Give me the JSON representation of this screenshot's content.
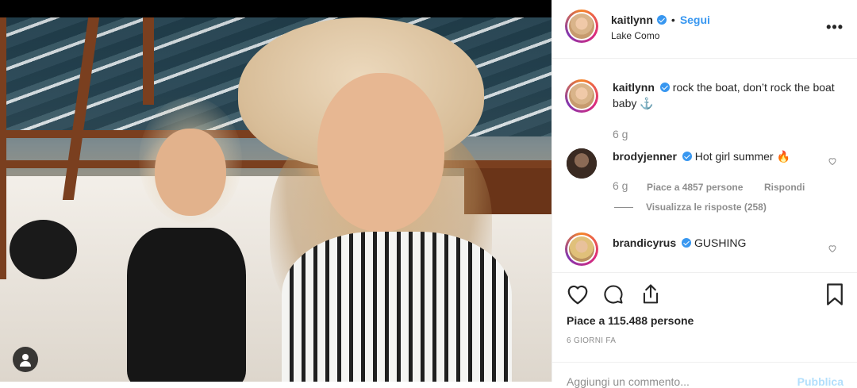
{
  "post": {
    "author": "kaitlynn",
    "follow_label": "Segui",
    "dot": "•",
    "location": "Lake Como",
    "more": "•••"
  },
  "caption": {
    "user": "kaitlynn",
    "text": "rock the boat, don’t rock the boat baby ⚓",
    "time": "6 g"
  },
  "comments": [
    {
      "user": "brodyjenner",
      "text": "Hot girl summer 🔥",
      "time": "6 g",
      "likes": "Piace a 4857 persone",
      "reply": "Rispondi",
      "view_replies": "Visualizza le risposte (258)"
    },
    {
      "user": "brandicyrus",
      "text": "GUSHING"
    }
  ],
  "actions": {
    "likes": "Piace a 115.488 persone",
    "date": "6 GIORNI FA"
  },
  "add_comment": {
    "placeholder": "Aggiungi un commento...",
    "publish": "Pubblica"
  },
  "colors": {
    "accent": "#3897f0",
    "text": "#262626",
    "muted": "#8e8e8e"
  }
}
